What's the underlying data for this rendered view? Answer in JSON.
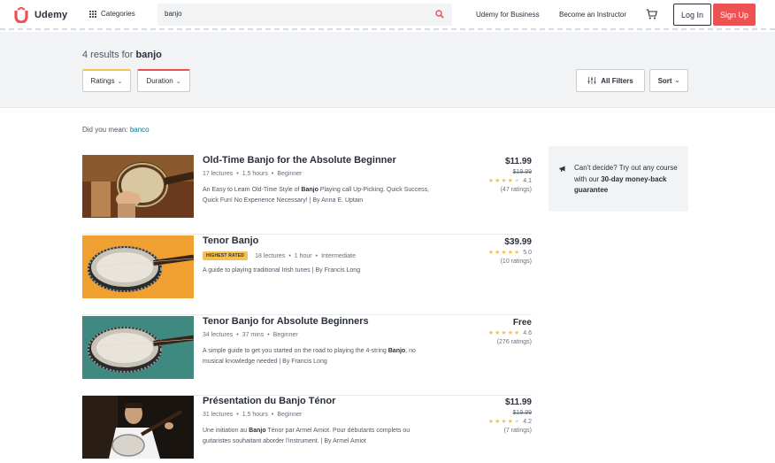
{
  "header": {
    "logo_text": "Udemy",
    "categories_label": "Categories",
    "search_value": "banjo",
    "udemy_business_label": "Udemy for Business",
    "become_instructor_label": "Become an Instructor",
    "login_label": "Log In",
    "signup_label": "Sign Up",
    "colors": {
      "brand": "#ec5252",
      "text": "#29303b"
    }
  },
  "results": {
    "count_prefix": "4 results for",
    "query": "banjo",
    "filters": [
      {
        "label": "Ratings",
        "icon": "chevron-down-icon"
      },
      {
        "label": "Duration",
        "icon": "chevron-down-icon"
      }
    ],
    "all_filters_label": "All Filters",
    "sort_label": "Sort"
  },
  "did_you_mean": {
    "prefix": "Did you mean:",
    "suggestion": "banco"
  },
  "courses": [
    {
      "title": "Old-Time Banjo for the Absolute Beginner",
      "badge": "",
      "lectures": "17 lectures",
      "duration": "1.5 hours",
      "level": "Beginner",
      "desc_before": "An Easy to Learn Old-Time Style of ",
      "desc_bold": "Banjo",
      "desc_after": " Playing call Up-Picking. Quick Success, Quick Fun! No Experience Necessary! | By Anna E. Uptain",
      "price": "$11.99",
      "old_price": "$19.99",
      "rating": "4.1",
      "rating_value": 4.1,
      "ratings_count": "(47 ratings)"
    },
    {
      "title": "Tenor Banjo",
      "badge": "HIGHEST RATED",
      "lectures": "18 lectures",
      "duration": "1 hour",
      "level": "Intermediate",
      "desc_before": "A guide to playing traditional Irish tunes | By Francis Long",
      "desc_bold": "",
      "desc_after": "",
      "price": "$39.99",
      "old_price": "",
      "rating": "5.0",
      "rating_value": 5.0,
      "ratings_count": "(10 ratings)"
    },
    {
      "title": "Tenor Banjo for Absolute Beginners",
      "badge": "",
      "lectures": "34 lectures",
      "duration": "37 mins",
      "level": "Beginner",
      "desc_before": "A simple guide to get you started on the road to playing the 4-string ",
      "desc_bold": "Banjo",
      "desc_after": ", no musical knowledge needed | By Francis Long",
      "price": "Free",
      "old_price": "",
      "rating": "4.6",
      "rating_value": 4.6,
      "ratings_count": "(276 ratings)"
    },
    {
      "title": "Présentation du Banjo Ténor",
      "badge": "",
      "lectures": "31 lectures",
      "duration": "1.5 hours",
      "level": "Beginner",
      "desc_before": "Une initiation au ",
      "desc_bold": "Banjo",
      "desc_after": " Ténor par Armel Amiot. Pour débutants complets ou guitaristes souhaitant aborder l'instrument. | By Armel Amiot",
      "price": "$11.99",
      "old_price": "$19.99",
      "rating": "4.2",
      "rating_value": 4.2,
      "ratings_count": "(7 ratings)"
    }
  ],
  "sidebar": {
    "text_before": "Can't decide? Try out any course with our ",
    "text_bold": "30-day money-back guarantee",
    "icon": "megaphone-icon"
  }
}
